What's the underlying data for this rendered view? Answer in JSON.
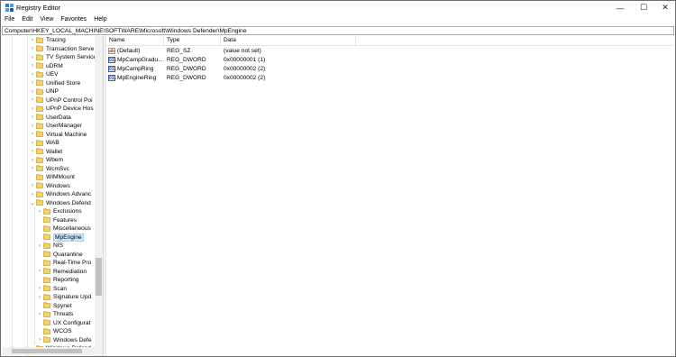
{
  "window": {
    "title": "Registry Editor"
  },
  "controls": {
    "minimize": "—",
    "maximize": "☐",
    "close": "✕"
  },
  "menu": [
    "File",
    "Edit",
    "View",
    "Favorites",
    "Help"
  ],
  "address": "Computer\\HKEY_LOCAL_MACHINE\\SOFTWARE\\Microsoft\\Windows Defender\\MpEngine",
  "tree": [
    {
      "label": "Tracing",
      "level": 1,
      "expander": "›"
    },
    {
      "label": "Transaction Serve",
      "level": 1,
      "expander": "›"
    },
    {
      "label": "TV System Service",
      "level": 1,
      "expander": "›"
    },
    {
      "label": "uDRM",
      "level": 1,
      "expander": "›"
    },
    {
      "label": "UEV",
      "level": 1,
      "expander": "›"
    },
    {
      "label": "Unified Store",
      "level": 1,
      "expander": "›"
    },
    {
      "label": "UNP",
      "level": 1,
      "expander": "›"
    },
    {
      "label": "UPnP Control Poi",
      "level": 1,
      "expander": "›"
    },
    {
      "label": "UPnP Device Hos",
      "level": 1,
      "expander": "›"
    },
    {
      "label": "UserData",
      "level": 1,
      "expander": "›"
    },
    {
      "label": "UserManager",
      "level": 1,
      "expander": "›"
    },
    {
      "label": "Virtual Machine",
      "level": 1,
      "expander": "›"
    },
    {
      "label": "WAB",
      "level": 1,
      "expander": "›"
    },
    {
      "label": "Wallet",
      "level": 1,
      "expander": "›"
    },
    {
      "label": "Wbem",
      "level": 1,
      "expander": "›"
    },
    {
      "label": "WcmSvc",
      "level": 1,
      "expander": "›"
    },
    {
      "label": "WIMMount",
      "level": 1,
      "expander": ""
    },
    {
      "label": "Windows",
      "level": 1,
      "expander": "›"
    },
    {
      "label": "Windows Advanc",
      "level": 1,
      "expander": "›"
    },
    {
      "label": "Windows Defend",
      "level": 1,
      "expander": "⌄"
    },
    {
      "label": "Exclusions",
      "level": 2,
      "expander": "›"
    },
    {
      "label": "Features",
      "level": 2,
      "expander": ""
    },
    {
      "label": "Miscellaneous",
      "level": 2,
      "expander": ""
    },
    {
      "label": "MpEngine",
      "level": 2,
      "expander": "",
      "selected": true
    },
    {
      "label": "NIS",
      "level": 2,
      "expander": "›"
    },
    {
      "label": "Quarantine",
      "level": 2,
      "expander": ""
    },
    {
      "label": "Real-Time Pro",
      "level": 2,
      "expander": ""
    },
    {
      "label": "Remediation",
      "level": 2,
      "expander": "›"
    },
    {
      "label": "Reporting",
      "level": 2,
      "expander": ""
    },
    {
      "label": "Scan",
      "level": 2,
      "expander": "›"
    },
    {
      "label": "Signature Upd",
      "level": 2,
      "expander": "›"
    },
    {
      "label": "Spynet",
      "level": 2,
      "expander": ""
    },
    {
      "label": "Threats",
      "level": 2,
      "expander": "›"
    },
    {
      "label": "UX Configurat",
      "level": 2,
      "expander": ""
    },
    {
      "label": "WCOS",
      "level": 2,
      "expander": ""
    },
    {
      "label": "Windows Defe",
      "level": 2,
      "expander": "›"
    },
    {
      "label": "Windows Defend",
      "level": 1,
      "expander": "›"
    }
  ],
  "columns": {
    "name": "Name",
    "type": "Type",
    "data": "Data"
  },
  "values": [
    {
      "name": "(Default)",
      "type": "REG_SZ",
      "data": "(value not set)",
      "icon": "ab"
    },
    {
      "name": "MpCampGradu...",
      "type": "REG_DWORD",
      "data": "0x00000001 (1)",
      "icon": "011"
    },
    {
      "name": "MpCampRing",
      "type": "REG_DWORD",
      "data": "0x00000002 (2)",
      "icon": "011"
    },
    {
      "name": "MpEngineRing",
      "type": "REG_DWORD",
      "data": "0x00000002 (2)",
      "icon": "011"
    }
  ]
}
